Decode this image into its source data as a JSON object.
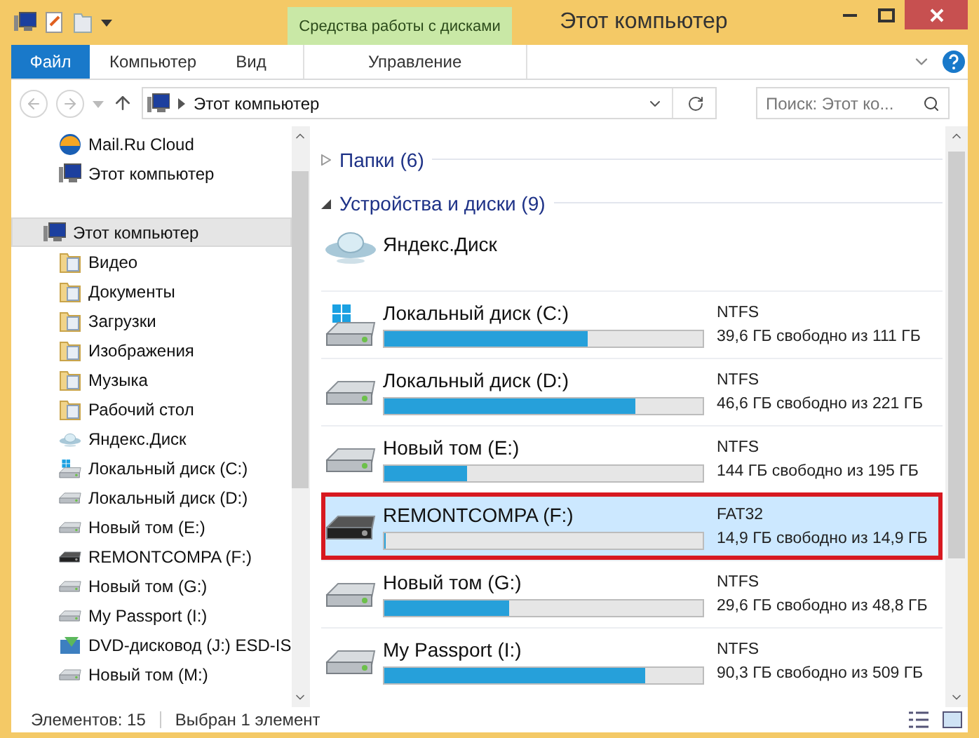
{
  "window": {
    "title": "Этот компьютер",
    "context_tab_group": "Средства работы с дисками"
  },
  "ribbon_tabs": [
    {
      "label": "Файл",
      "kind": "file",
      "selected": false
    },
    {
      "label": "Компьютер",
      "kind": "tab",
      "selected": false
    },
    {
      "label": "Вид",
      "kind": "tab",
      "selected": false
    },
    {
      "label": "Управление",
      "kind": "context",
      "selected": false
    }
  ],
  "address_bar": {
    "path": "Этот компьютер"
  },
  "search": {
    "placeholder": "Поиск: Этот ко..."
  },
  "sidebar": {
    "top_items": [
      {
        "label": "Mail.Ru Cloud",
        "kind": "mailcloud"
      },
      {
        "label": "Этот компьютер",
        "kind": "computer"
      }
    ],
    "tree": {
      "label": "Этот компьютер",
      "kind": "computer",
      "selected": true,
      "children": [
        {
          "label": "Видео",
          "kind": "folder"
        },
        {
          "label": "Документы",
          "kind": "folder"
        },
        {
          "label": "Загрузки",
          "kind": "folder"
        },
        {
          "label": "Изображения",
          "kind": "folder"
        },
        {
          "label": "Музыка",
          "kind": "folder"
        },
        {
          "label": "Рабочий стол",
          "kind": "folder"
        },
        {
          "label": "Яндекс.Диск",
          "kind": "cloud"
        },
        {
          "label": "Локальный диск (C:)",
          "kind": "system"
        },
        {
          "label": "Локальный диск (D:)",
          "kind": "drive"
        },
        {
          "label": "Новый том (E:)",
          "kind": "drive"
        },
        {
          "label": "REMONTCOMPA (F:)",
          "kind": "usb"
        },
        {
          "label": "Новый том (G:)",
          "kind": "drive"
        },
        {
          "label": "My Passport (I:)",
          "kind": "drive"
        },
        {
          "label": "DVD-дисковод (J:) ESD-IS",
          "kind": "dvd"
        },
        {
          "label": "Новый том (M:)",
          "kind": "drive"
        }
      ]
    }
  },
  "groups": [
    {
      "title": "Папки (6)",
      "expanded": false
    },
    {
      "title": "Устройства и диски (9)",
      "expanded": true
    }
  ],
  "devices": [
    {
      "name": "Яндекс.Диск",
      "kind": "cloud",
      "selected": false,
      "annotated": false
    },
    {
      "name": "Локальный диск (C:)",
      "kind": "system",
      "filesystem": "NTFS",
      "free": "39,6 ГБ свободно из 111 ГБ",
      "level": 0.64,
      "selected": false,
      "annotated": false
    },
    {
      "name": "Локальный диск (D:)",
      "kind": "drive",
      "filesystem": "NTFS",
      "free": "46,6 ГБ свободно из 221 ГБ",
      "level": 0.79,
      "selected": false,
      "annotated": false
    },
    {
      "name": "Новый том (E:)",
      "kind": "drive",
      "filesystem": "NTFS",
      "free": "144 ГБ свободно из 195 ГБ",
      "level": 0.26,
      "selected": false,
      "annotated": false
    },
    {
      "name": "REMONTCOMPA (F:)",
      "kind": "usb",
      "filesystem": "FAT32",
      "free": "14,9 ГБ свободно из 14,9 ГБ",
      "level": 0,
      "selected": true,
      "annotated": true
    },
    {
      "name": "Новый том (G:)",
      "kind": "drive",
      "filesystem": "NTFS",
      "free": "29,6 ГБ свободно из 48,8 ГБ",
      "level": 0.39,
      "selected": false,
      "annotated": false
    },
    {
      "name": "My Passport (I:)",
      "kind": "drive",
      "filesystem": "NTFS",
      "free": "90,3 ГБ свободно из 509 ГБ",
      "level": 0.82,
      "selected": false,
      "annotated": false
    }
  ],
  "status_bar": {
    "count": "Элементов: 15",
    "selection": "Выбран 1 элемент"
  }
}
